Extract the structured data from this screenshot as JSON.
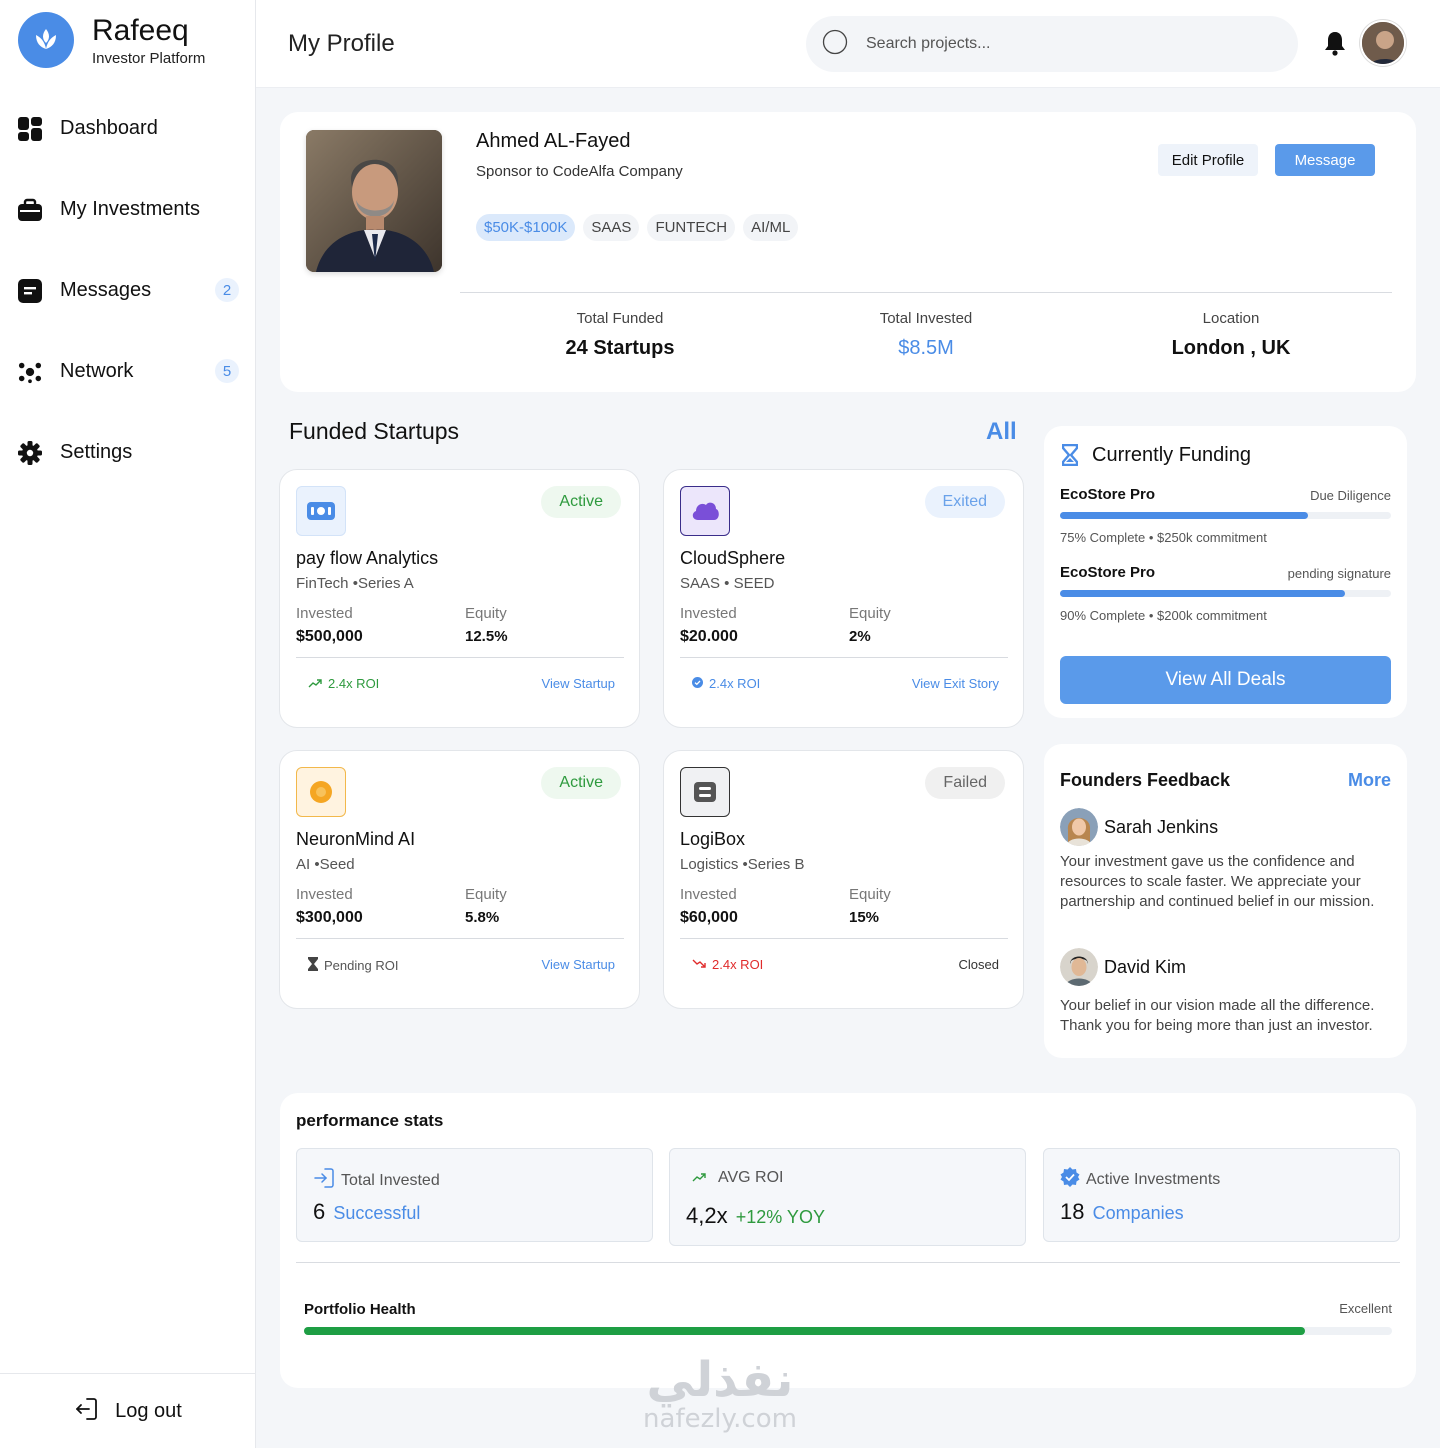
{
  "brand": {
    "name": "Rafeeq",
    "subtitle": "Investor Platform",
    "color": "#4a8ce6"
  },
  "sidebar": {
    "items": [
      {
        "label": "Dashboard",
        "icon": "dashboard-icon"
      },
      {
        "label": "My Investments",
        "icon": "briefcase-icon"
      },
      {
        "label": "Messages",
        "icon": "message-icon",
        "badge": "2"
      },
      {
        "label": "Network",
        "icon": "network-icon",
        "badge": "5"
      },
      {
        "label": "Settings",
        "icon": "gear-icon"
      }
    ],
    "logout": "Log out"
  },
  "header": {
    "title": "My Profile",
    "search_placeholder": "Search projects..."
  },
  "profile": {
    "name": "Ahmed  AL-Fayed",
    "role": "Sponsor to CodeAlfa Company",
    "tags": [
      "$50K-$100K",
      "SAAS",
      "FUNTECH",
      "AI/ML"
    ],
    "edit_label": "Edit Profile",
    "message_label": "Message",
    "stats": [
      {
        "label": "Total Funded",
        "value": "24 Startups"
      },
      {
        "label": "Total Invested",
        "value": "$8.5M"
      },
      {
        "label": "Location",
        "value": "London , UK"
      }
    ]
  },
  "funded": {
    "title": "Funded Startups",
    "all_label": "All",
    "cards": [
      {
        "name": "pay flow Analytics",
        "category": "FinTech •Series A",
        "status": "Active",
        "invested_label": "Invested",
        "invested": "$500,000",
        "equity_label": "Equity",
        "equity": "12.5%",
        "roi": "2.4x ROI",
        "action": "View Startup"
      },
      {
        "name": "CloudSphere",
        "category": "SAAS • SEED",
        "status": "Exited",
        "invested_label": "Invested",
        "invested": "$20.000",
        "equity_label": "Equity",
        "equity": "2%",
        "roi": "2.4x ROI",
        "action": "View Exit Story"
      },
      {
        "name": "NeuronMind AI",
        "category": "AI •Seed",
        "status": "Active",
        "invested_label": "Invested",
        "invested": "$300,000",
        "equity_label": "Equity",
        "equity": "5.8%",
        "roi": "Pending ROI",
        "action": "View Startup"
      },
      {
        "name": "LogiBox",
        "category": "Logistics •Series B",
        "status": "Failed",
        "invested_label": "Invested",
        "invested": "$60,000",
        "equity_label": "Equity",
        "equity": "15%",
        "roi": "2.4x ROI",
        "action": "Closed"
      }
    ]
  },
  "funding": {
    "title": "Currently Funding",
    "deals": [
      {
        "name": "EcoStore Pro",
        "stage": "Due Diligence",
        "progress": 0.75,
        "meta": "75% Complete • $250k commitment"
      },
      {
        "name": "EcoStore Pro",
        "stage": "pending signature",
        "progress": 0.86,
        "meta": "90% Complete • $200k commitment"
      }
    ],
    "button": "View All Deals"
  },
  "feedback": {
    "title": "Founders Feedback",
    "more": "More",
    "items": [
      {
        "name": "Sarah Jenkins",
        "text": "Your investment gave us the confidence and resources to scale faster. We appreciate your partnership and continued belief in our mission."
      },
      {
        "name": "David Kim",
        "text": "Your belief in our vision made all the difference. Thank you for being more than just an investor."
      }
    ]
  },
  "performance": {
    "title": "performance stats",
    "boxes": [
      {
        "label": "Total Invested",
        "value": "6",
        "sub": "Successful"
      },
      {
        "label": "AVG ROI",
        "value": "4,2x",
        "sub": "+12% YOY"
      },
      {
        "label": "Active Investments",
        "value": "18",
        "sub": "Companies"
      }
    ],
    "health_label": "Portfolio Health",
    "health_status": "Excellent",
    "health_progress": 0.92
  },
  "watermark": {
    "arabic": "نفذلي",
    "latin": "nafezly.com"
  }
}
